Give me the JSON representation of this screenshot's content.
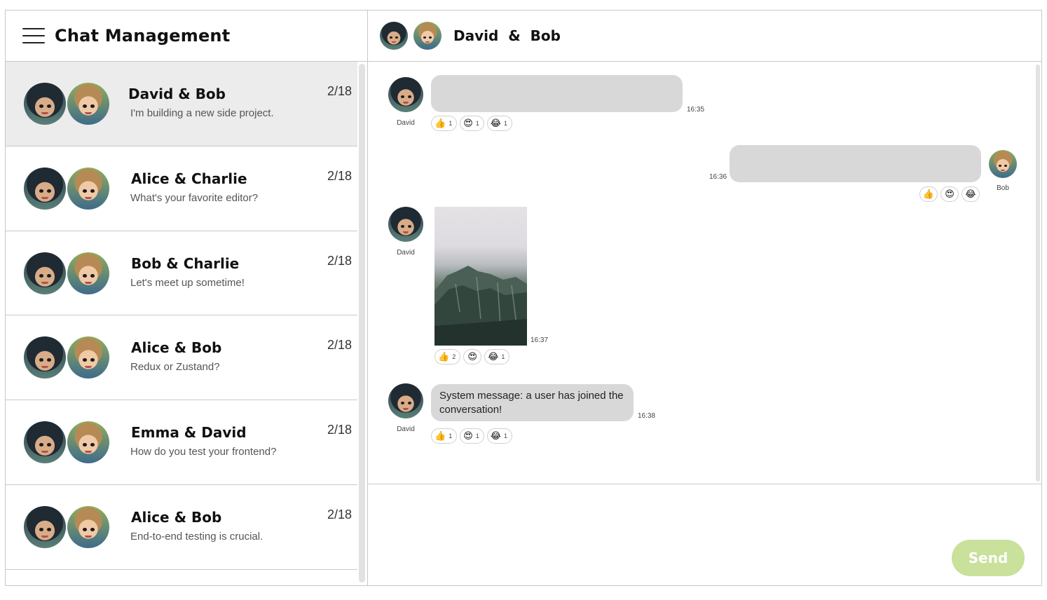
{
  "sidebar": {
    "title": "Chat Management",
    "menu_icon": "hamburger-menu-icon",
    "conversations": [
      {
        "name_a": "David",
        "name_b": "Bob",
        "preview": "I'm building a new side project.",
        "date": "2/18",
        "active": true
      },
      {
        "name_a": "Alice",
        "name_b": "Charlie",
        "preview": "What's your favorite editor?",
        "date": "2/18",
        "active": false
      },
      {
        "name_a": "Bob",
        "name_b": "Charlie",
        "preview": "Let's meet up sometime!",
        "date": "2/18",
        "active": false
      },
      {
        "name_a": "Alice",
        "name_b": "Bob",
        "preview": "Redux or Zustand?",
        "date": "2/18",
        "active": false
      },
      {
        "name_a": "Emma",
        "name_b": "David",
        "preview": "How do you test your frontend?",
        "date": "2/18",
        "active": false
      },
      {
        "name_a": "Alice",
        "name_b": "Bob",
        "preview": "End-to-end testing is crucial.",
        "date": "2/18",
        "active": false
      }
    ]
  },
  "chat": {
    "participant_a": "David",
    "amp": "&",
    "participant_b": "Bob",
    "messages": [
      {
        "sender": "David",
        "text": "",
        "time": "16:35",
        "reactions": [
          {
            "icon": "thumbs-up-icon",
            "emoji": "👍",
            "count": "1"
          },
          {
            "icon": "heart-eyes-icon",
            "emoji": "😍",
            "count": "1"
          },
          {
            "icon": "laughing-icon",
            "emoji": "😂",
            "count": "1"
          }
        ]
      },
      {
        "sender": "Bob",
        "text": "",
        "time": "16:36",
        "reactions": [
          {
            "icon": "thumbs-up-icon",
            "emoji": "👍",
            "count": ""
          },
          {
            "icon": "heart-eyes-icon",
            "emoji": "😍",
            "count": ""
          },
          {
            "icon": "laughing-icon",
            "emoji": "😂",
            "count": ""
          }
        ]
      },
      {
        "sender": "David",
        "type": "image",
        "image_desc": "misty-mountain-photo",
        "time": "16:37",
        "reactions": [
          {
            "icon": "thumbs-up-icon",
            "emoji": "👍",
            "count": "2"
          },
          {
            "icon": "heart-eyes-icon",
            "emoji": "😍",
            "count": ""
          },
          {
            "icon": "laughing-icon",
            "emoji": "😂",
            "count": "1"
          }
        ]
      },
      {
        "sender": "David",
        "text": "System message: a user has joined the conversation!",
        "time": "16:38",
        "reactions": [
          {
            "icon": "thumbs-up-icon",
            "emoji": "👍",
            "count": "1"
          },
          {
            "icon": "heart-eyes-icon",
            "emoji": "😍",
            "count": "1"
          },
          {
            "icon": "laughing-icon",
            "emoji": "😂",
            "count": "1"
          }
        ]
      }
    ]
  },
  "composer": {
    "send_label": "Send"
  },
  "colors": {
    "send_button": "#c9e19b",
    "active_conversation_bg": "#ececec",
    "bubble_bg": "#d8d8d8",
    "border": "#c8c8c8"
  }
}
